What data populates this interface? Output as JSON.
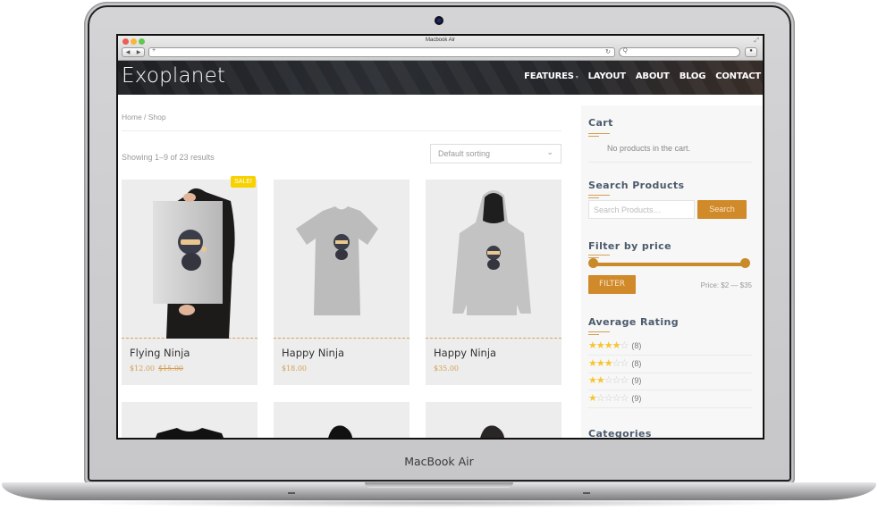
{
  "device": {
    "label": "MacBook Air"
  },
  "browser": {
    "window_title": "Macbook Air",
    "url": "",
    "search_placeholder": "Q",
    "back_icon": "◀",
    "forward_icon": "▶",
    "new_tab_icon": "+",
    "reload_icon": "↻",
    "info_icon": "●",
    "expand_icon": "⤢"
  },
  "site": {
    "logo": "Exoplanet",
    "nav": [
      {
        "label": "FEATURES",
        "has_dropdown": true
      },
      {
        "label": "LAYOUT"
      },
      {
        "label": "ABOUT"
      },
      {
        "label": "BLOG"
      },
      {
        "label": "CONTACT"
      }
    ],
    "caret": "▾"
  },
  "shop": {
    "breadcrumb": "Home / Shop",
    "result_count": "Showing 1–9 of 23 results",
    "sorting": {
      "selected": "Default sorting",
      "chevron": "⌄"
    },
    "products": [
      {
        "name": "Flying Ninja",
        "price": "$12.00",
        "old_price": "$15.00",
        "badge": "SALE!"
      },
      {
        "name": "Happy Ninja",
        "price": "$18.00"
      },
      {
        "name": "Happy Ninja",
        "price": "$35.00"
      }
    ]
  },
  "sidebar": {
    "cart": {
      "title": "Cart",
      "empty_text": "No products in the cart."
    },
    "search": {
      "title": "Search Products",
      "placeholder": "Search Products…",
      "button": "Search"
    },
    "price_filter": {
      "title": "Filter by price",
      "button": "FILTER",
      "range_text": "Price: $2 — $35",
      "min": 2,
      "max": 35
    },
    "average_rating": {
      "title": "Average Rating",
      "rows": [
        {
          "stars": 4,
          "count": "(8)"
        },
        {
          "stars": 3,
          "count": "(8)"
        },
        {
          "stars": 2,
          "count": "(9)"
        },
        {
          "stars": 1,
          "count": "(9)"
        }
      ]
    },
    "categories": {
      "title": "Categories"
    }
  },
  "colors": {
    "accent": "#d08a2a",
    "sale": "#f8d200",
    "star": "#f7c531",
    "header_bg": "#26282c"
  }
}
